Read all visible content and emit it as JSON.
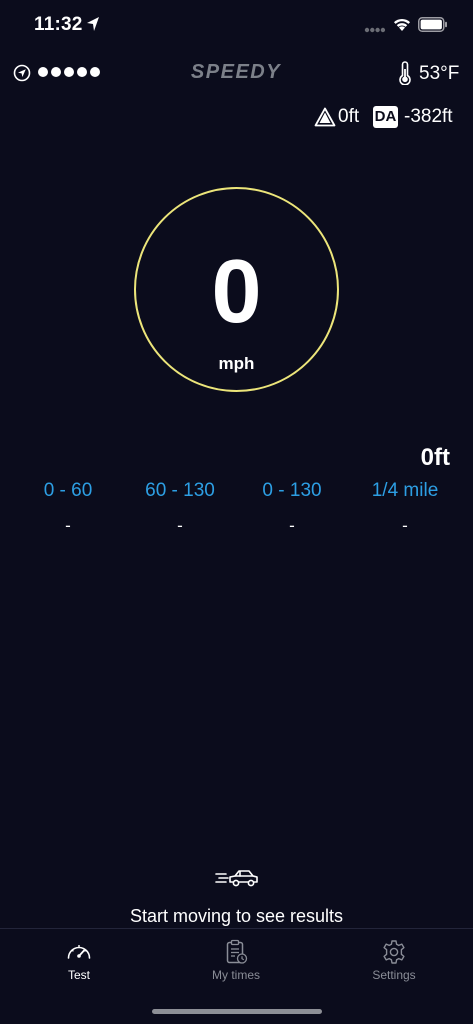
{
  "status_bar": {
    "time": "11:32"
  },
  "header": {
    "brand": "SPEEDY",
    "gps_signal_dots": 5,
    "temperature": "53°F"
  },
  "altitude": {
    "elevation": "0ft",
    "da_badge": "DA",
    "density_altitude": "-382ft"
  },
  "speedometer": {
    "speed": "0",
    "unit": "mph"
  },
  "distance": "0ft",
  "metrics": [
    {
      "label": "0 - 60",
      "value": "-"
    },
    {
      "label": "60 - 130",
      "value": "-"
    },
    {
      "label": "0 - 130",
      "value": "-"
    },
    {
      "label": "1/4 mile",
      "value": "-"
    }
  ],
  "empty_state": {
    "message": "Start moving to see results"
  },
  "tabs": [
    {
      "label": "Test",
      "active": true
    },
    {
      "label": "My times",
      "active": false
    },
    {
      "label": "Settings",
      "active": false
    }
  ],
  "colors": {
    "background": "#0b0c1c",
    "gauge_ring": "#ece57a",
    "metric_label": "#2d9fe4",
    "brand": "#7c8089"
  }
}
